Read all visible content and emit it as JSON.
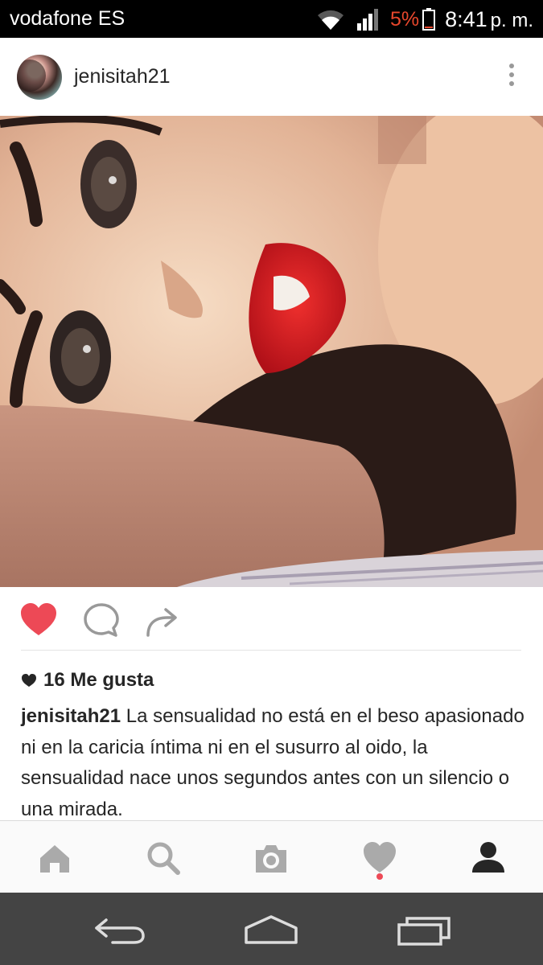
{
  "status_bar": {
    "carrier": "vodafone ES",
    "battery_percent": "5%",
    "time": "8:41",
    "time_suffix": "p. m.",
    "battery_color": "#e8472c"
  },
  "post": {
    "username": "jenisitah21",
    "likes": "16 Me gusta",
    "caption_user": "jenisitah21",
    "caption_text": "La sensualidad no está en el beso apasionado ni en la caricia íntima ni en el susurro al oido, la sensualidad nace unos segundos antes con un silencio o una mirada.",
    "liked": true,
    "like_color": "#ed4956"
  },
  "actions": {
    "icons": [
      "heart-icon",
      "comment-icon",
      "share-icon"
    ]
  },
  "tab_bar": {
    "tabs": [
      "home-icon",
      "search-icon",
      "camera-icon",
      "activity-heart-icon",
      "profile-icon"
    ],
    "active": "profile-icon",
    "has_activity_notification": true
  },
  "nav_bar": {
    "buttons": [
      "back-icon",
      "home-icon",
      "recent-apps-icon"
    ]
  }
}
